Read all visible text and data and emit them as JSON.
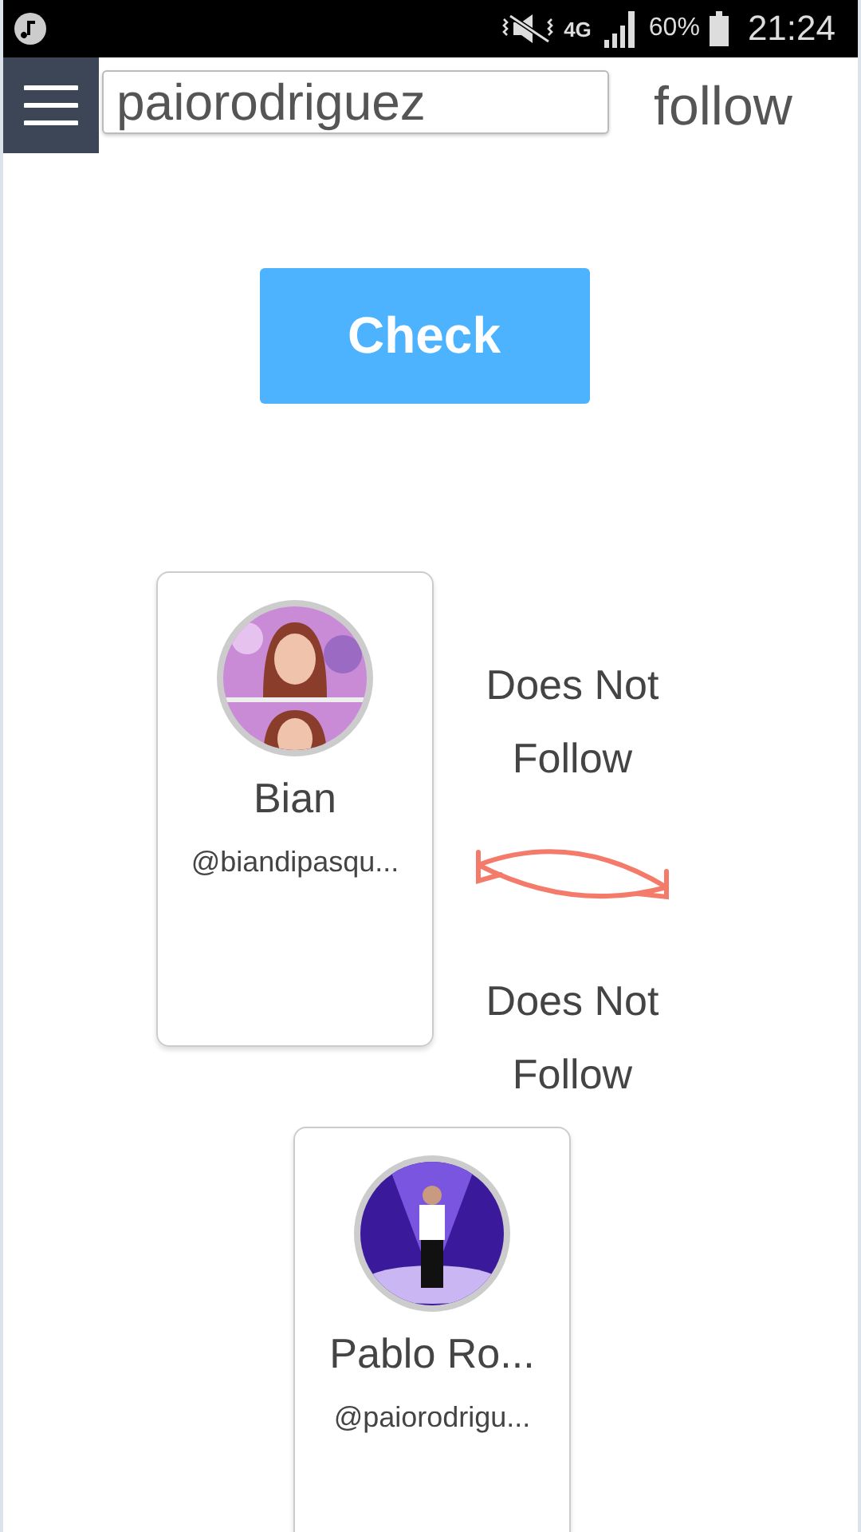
{
  "status_bar": {
    "network": "4G",
    "battery": "60%",
    "time": "21:24"
  },
  "header": {
    "username": "paiorodriguez",
    "mode_label": "follow"
  },
  "check_button": "Check",
  "users": [
    {
      "name": "Bian",
      "handle": "@biandipasqu..."
    },
    {
      "name": "Pablo Ro...",
      "handle": "@paiorodrigu..."
    }
  ],
  "relations": [
    "Does Not Follow",
    "Does Not Follow"
  ]
}
